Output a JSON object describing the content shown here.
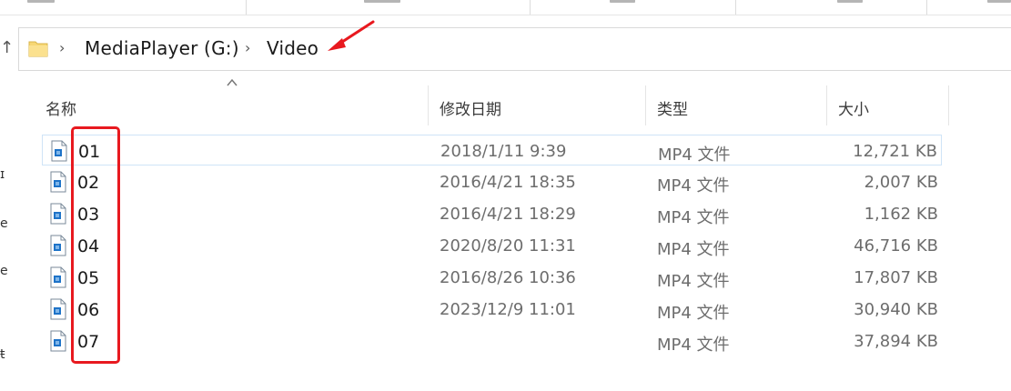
{
  "address_bar": {
    "breadcrumbs": [
      "MediaPlayer (G:)",
      "Video"
    ]
  },
  "columns": [
    {
      "key": "name",
      "label": "名称"
    },
    {
      "key": "date",
      "label": "修改日期"
    },
    {
      "key": "type",
      "label": "类型"
    },
    {
      "key": "size",
      "label": "大小"
    }
  ],
  "files": [
    {
      "name": "01",
      "date": "2018/1/11 9:39",
      "type": "MP4 文件",
      "size": "12,721 KB"
    },
    {
      "name": "02",
      "date": "2016/4/21 18:35",
      "type": "MP4 文件",
      "size": "2,007 KB"
    },
    {
      "name": "03",
      "date": "2016/4/21 18:29",
      "type": "MP4 文件",
      "size": "1,162 KB"
    },
    {
      "name": "04",
      "date": "2020/8/20 11:31",
      "type": "MP4 文件",
      "size": "46,716 KB"
    },
    {
      "name": "05",
      "date": "2016/8/26 10:36",
      "type": "MP4 文件",
      "size": "17,807 KB"
    },
    {
      "name": "06",
      "date": "2023/12/9 11:01",
      "type": "MP4 文件",
      "size": "30,940 KB"
    },
    {
      "name": "07",
      "date": "",
      "type": "MP4 文件",
      "size": "37,894 KB"
    }
  ],
  "selected_index": 0,
  "colors": {
    "annotation_red": "#e8191f",
    "selection_border": "#cfe4f7",
    "folder_yellow": "#f7d774",
    "file_icon_blue": "#1e73c8"
  }
}
